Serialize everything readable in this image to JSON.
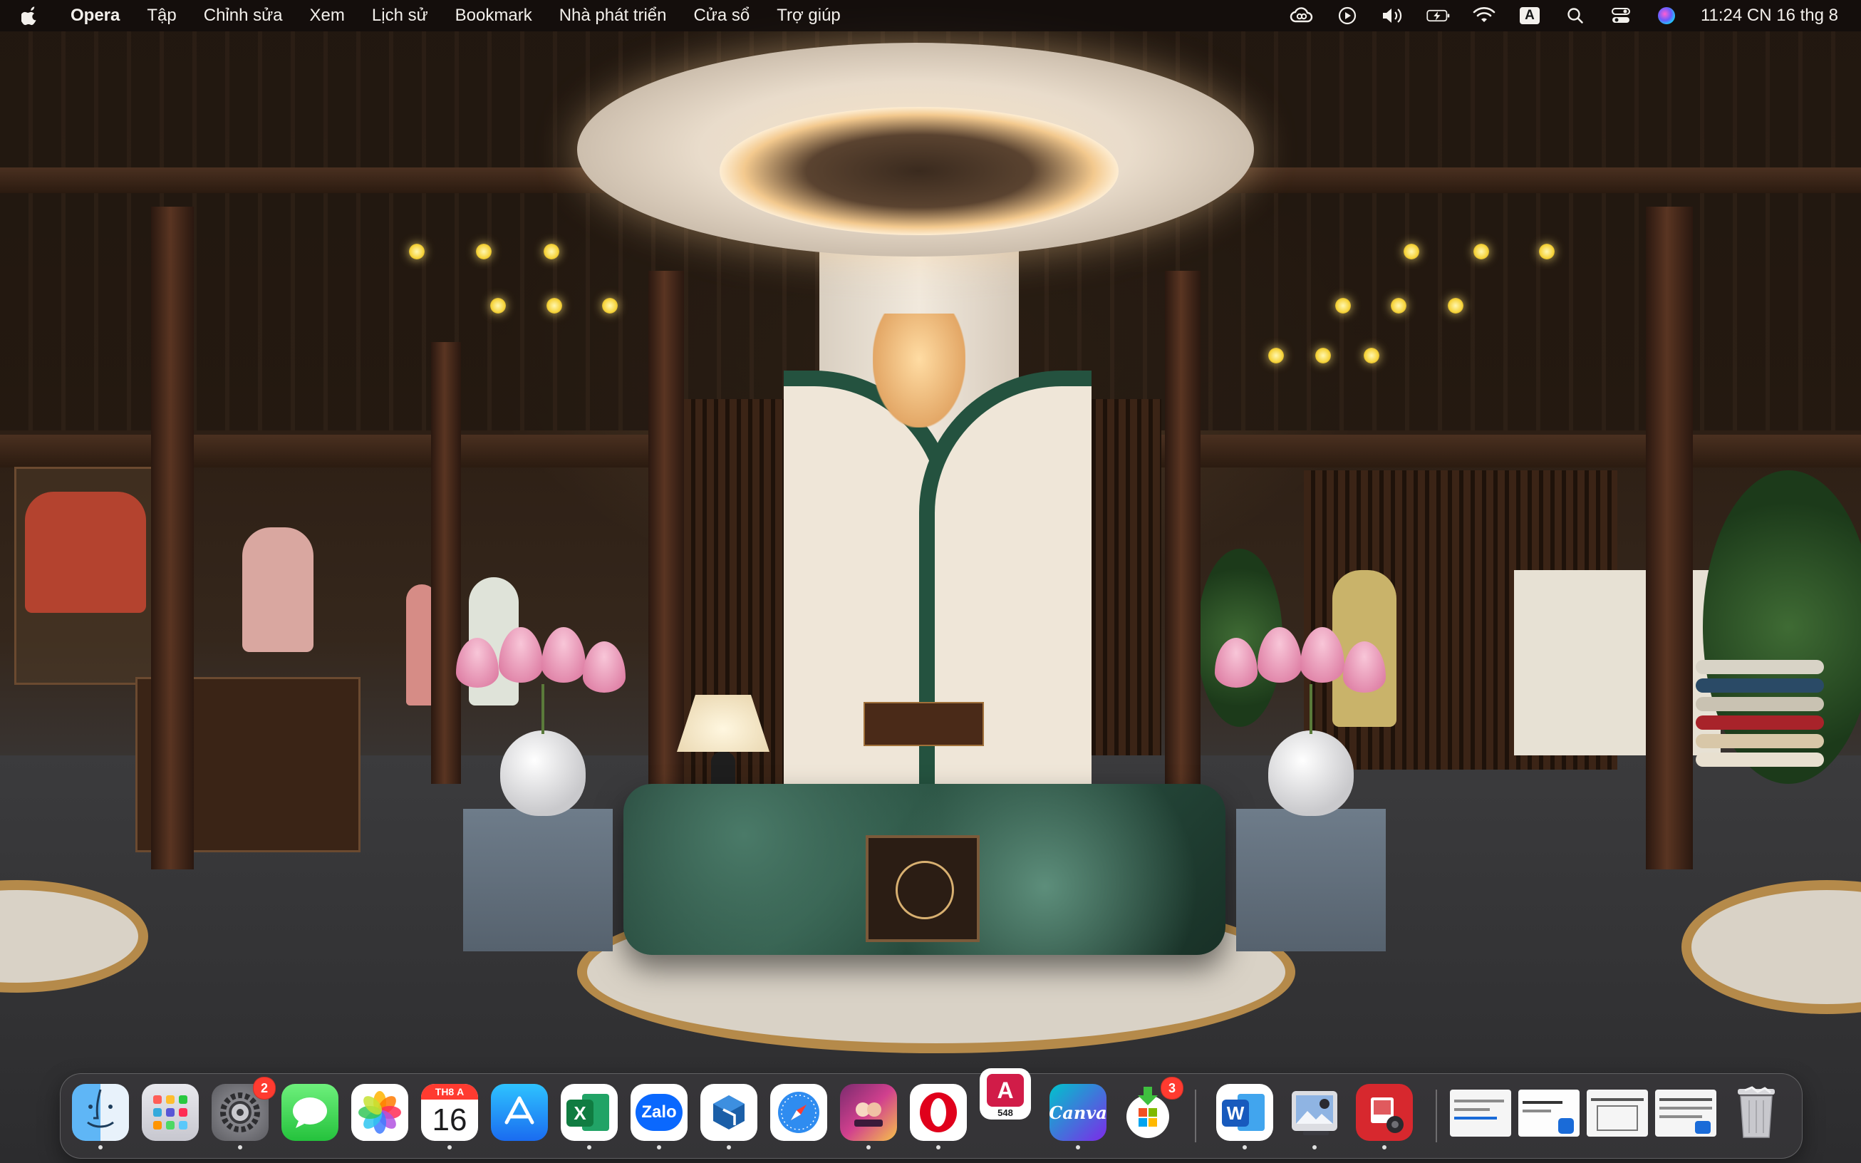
{
  "menubar": {
    "app_name": "Opera",
    "menus": [
      "Tập",
      "Chỉnh sửa",
      "Xem",
      "Lịch sử",
      "Bookmark",
      "Nhà phát triển",
      "Cửa sổ",
      "Trợ giúp"
    ],
    "input_source": "A",
    "clock": "11:24 CN 16 thg 8",
    "status_icons": [
      "creative-cloud-icon",
      "play-circle-icon",
      "volume-icon",
      "battery-charging-icon",
      "wifi-icon",
      "input-source-icon",
      "search-icon",
      "control-center-icon",
      "siri-icon"
    ]
  },
  "dock": {
    "apps": [
      {
        "name": "Finder",
        "icon": "finder-icon"
      },
      {
        "name": "Launchpad",
        "icon": "launchpad-icon"
      },
      {
        "name": "System Settings",
        "icon": "settings-icon",
        "badge": "2"
      },
      {
        "name": "Messages",
        "icon": "messages-icon"
      },
      {
        "name": "Photos",
        "icon": "photos-icon"
      },
      {
        "name": "Calendar",
        "icon": "calendar-icon",
        "month": "TH8",
        "weekday": "A",
        "day": "16"
      },
      {
        "name": "App Store",
        "icon": "app-store-icon"
      },
      {
        "name": "Excel",
        "icon": "excel-icon",
        "letter": "X"
      },
      {
        "name": "Zalo",
        "icon": "zalo-icon",
        "label": "Zalo"
      },
      {
        "name": "SketchUp",
        "icon": "sketchup-icon"
      },
      {
        "name": "Safari",
        "icon": "safari-icon"
      },
      {
        "name": "Game",
        "icon": "game-icon"
      },
      {
        "name": "Opera",
        "icon": "opera-icon"
      },
      {
        "name": "Affinity",
        "icon": "affinity-icon",
        "letter": "A",
        "count": "548"
      },
      {
        "name": "Canva",
        "icon": "canva-icon",
        "label": "Canva"
      },
      {
        "name": "Microsoft Store",
        "icon": "ms-installer-icon",
        "badge": "3"
      },
      {
        "name": "Word",
        "icon": "word-icon",
        "letter": "W"
      },
      {
        "name": "Preview",
        "icon": "preview-icon"
      },
      {
        "name": "Photo Booth",
        "icon": "photo-booth-icon"
      }
    ],
    "minimized": [
      "window-thumbnail-1",
      "window-thumbnail-2",
      "window-thumbnail-3",
      "window-thumbnail-4"
    ],
    "trash": "trash-icon"
  },
  "colors": {
    "menubar_text": "#f3f0ec",
    "badge_red": "#ff3b30",
    "excel_green": "#107c41",
    "word_blue": "#185abd",
    "zalo_blue": "#0a68fe",
    "opera_red": "#e0001b"
  }
}
